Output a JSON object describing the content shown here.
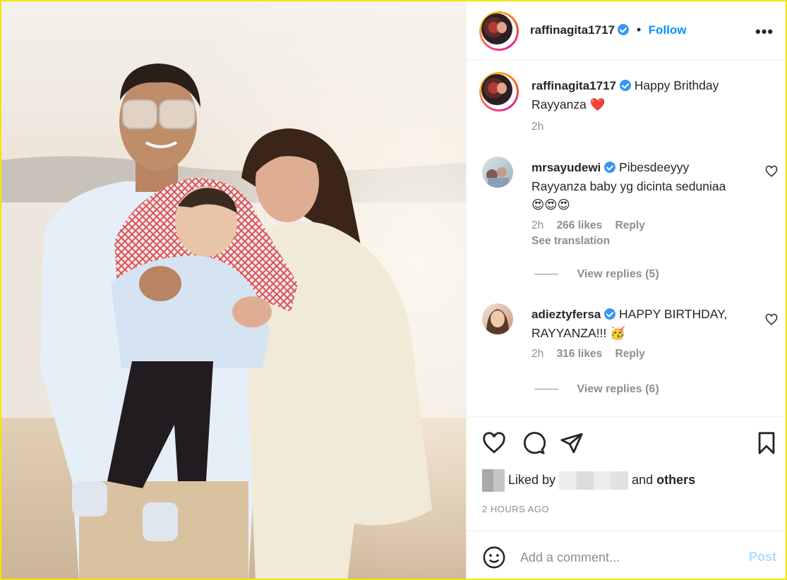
{
  "header": {
    "username": "raffinagita1717",
    "separator": "•",
    "follow_label": "Follow",
    "more_label": "•••"
  },
  "caption": {
    "username": "raffinagita1717",
    "text_line1": "Happy Brithday",
    "text_line2": "Rayyanza",
    "emoji": "❤️",
    "time": "2h"
  },
  "comments": [
    {
      "username": "mrsayudewi",
      "text_line1": "Pibesdeeyyy",
      "text_line2": "Rayyanza baby yg dicinta seduniaa",
      "text_line3": "😍😍😍",
      "time": "2h",
      "likes": "266 likes",
      "reply": "Reply",
      "see_translation": "See translation",
      "view_replies": "View replies (5)"
    },
    {
      "username": "adieztyfersa",
      "text_line1": "HAPPY BIRTHDAY,",
      "text_line2": "RAYYANZA!!! 🥳",
      "time": "2h",
      "likes": "316 likes",
      "reply": "Reply",
      "view_replies": "View replies (6)"
    }
  ],
  "actions": {
    "liked_by": "Liked by",
    "and": "and",
    "others": "others",
    "time_ago": "2 HOURS AGO"
  },
  "comment_box": {
    "placeholder": "Add a comment...",
    "post_label": "Post"
  },
  "icons": {
    "verified": "verified-badge-icon",
    "like": "heart-icon",
    "comment": "comment-bubble-icon",
    "share": "paper-plane-icon",
    "save": "bookmark-icon",
    "emoji": "smiley-icon"
  },
  "colors": {
    "accent": "#0095f6",
    "verified": "#3897f0",
    "frame_border": "#f2e600",
    "muted": "#8e8e8e",
    "post_disabled": "#b3dbff"
  }
}
